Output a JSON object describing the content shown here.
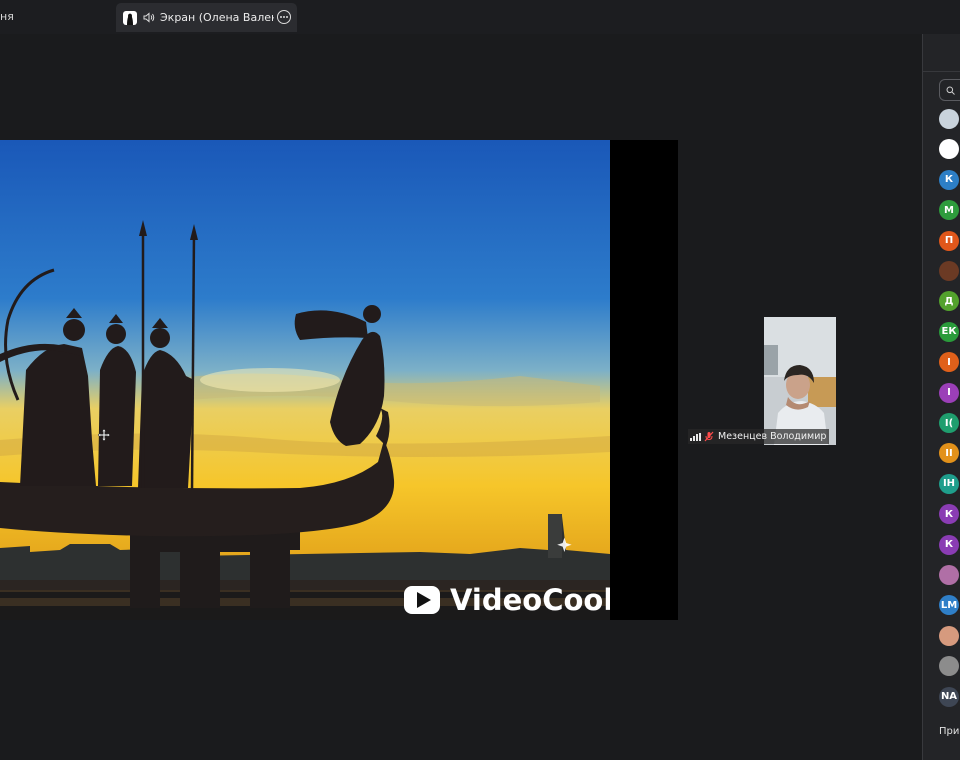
{
  "tabs": {
    "previous_label": "ня",
    "active_title": "Экран (Олена Валентинівна"
  },
  "share": {
    "watermark": "VideoCook"
  },
  "participant_tile": {
    "name": "Мезенцев Володимир"
  },
  "panel": {
    "avatars": [
      {
        "letter": "",
        "color": "#c9d3dc"
      },
      {
        "letter": "",
        "color": "#ffffff"
      },
      {
        "letter": "К",
        "color": "#2d7fc6"
      },
      {
        "letter": "М",
        "color": "#2e9c3d"
      },
      {
        "letter": "П",
        "color": "#e0571b"
      },
      {
        "letter": "",
        "color": "#6b3a24"
      },
      {
        "letter": "Д",
        "color": "#53a22d"
      },
      {
        "letter": "ЕК",
        "color": "#2a9b3b"
      },
      {
        "letter": "І",
        "color": "#e0601a"
      },
      {
        "letter": "І",
        "color": "#9b3fb8"
      },
      {
        "letter": "І(",
        "color": "#1f9e6e"
      },
      {
        "letter": "ІІ",
        "color": "#e2911a"
      },
      {
        "letter": "ІН",
        "color": "#1f9e8c"
      },
      {
        "letter": "К",
        "color": "#8a3cb4"
      },
      {
        "letter": "К",
        "color": "#8a3cb4"
      },
      {
        "letter": "",
        "color": "#b06fa6"
      },
      {
        "letter": "LM",
        "color": "#2f7fc8"
      },
      {
        "letter": "",
        "color": "#d69a7e"
      },
      {
        "letter": "",
        "color": "#8c8c8c"
      },
      {
        "letter": "NA",
        "color": "#3e4654"
      }
    ],
    "invite_label": "Приг"
  },
  "colors": {
    "background": "#1a1b1d",
    "panel": "#232427",
    "sky_top": "#1f61bd",
    "sky_horizon": "#f3c82e"
  }
}
